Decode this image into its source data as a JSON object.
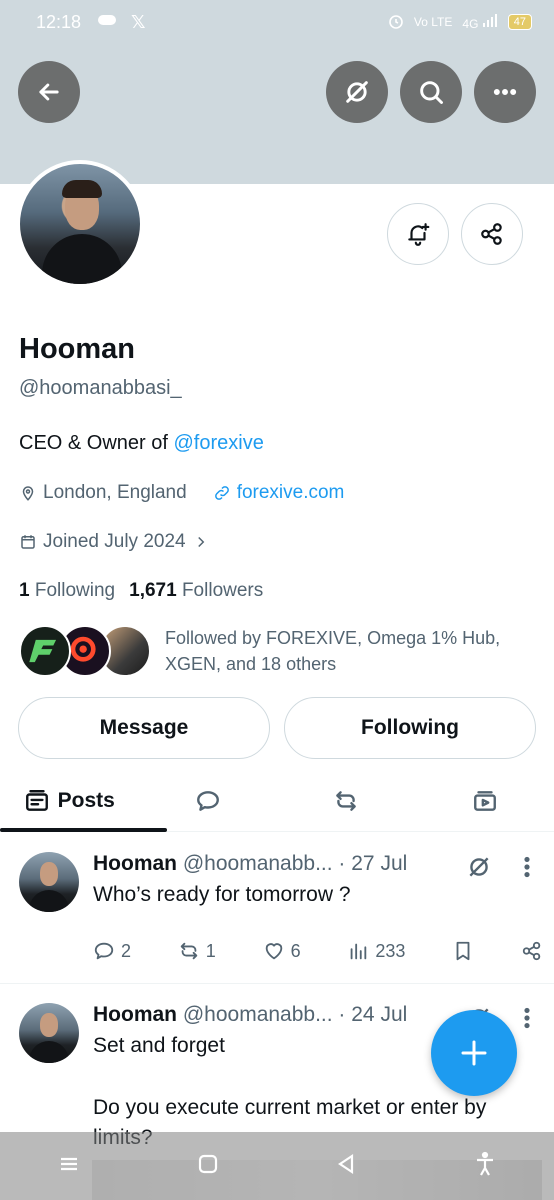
{
  "status_bar": {
    "time": "12:18",
    "network_label": "Vo LTE",
    "signal_label": "4G",
    "battery": "47"
  },
  "profile": {
    "name": "Hooman",
    "handle": "@hoomanabbasi_",
    "bio_prefix": "CEO & Owner of ",
    "bio_link": "@forexive",
    "location": "London, England",
    "website": "forexive.com",
    "joined": "Joined July 2024",
    "following_count": "1",
    "following_label": "Following",
    "followers_count": "1,671",
    "followers_label": "Followers",
    "followed_by": "Followed by FOREXIVE, Omega 1% Hub, XGEN, and 18 others"
  },
  "buttons": {
    "message": "Message",
    "following": "Following"
  },
  "tabs": [
    {
      "label": "Posts",
      "icon": "posts-icon",
      "active": true
    },
    {
      "label": "",
      "icon": "replies-icon",
      "active": false
    },
    {
      "label": "",
      "icon": "repost-icon",
      "active": false
    },
    {
      "label": "",
      "icon": "media-icon",
      "active": false
    }
  ],
  "posts": [
    {
      "name": "Hooman",
      "handle_date": "@hoomanabb... · 27 Jul",
      "text": "Who’s ready for tomorrow ?",
      "replies": "2",
      "reposts": "1",
      "likes": "6",
      "views": "233"
    },
    {
      "name": "Hooman",
      "handle_date": "@hoomanabb... · 24 Jul",
      "text_line1": "Set and forget",
      "text_line2": "Do you execute current market or enter by limits?"
    }
  ],
  "colors": {
    "accent": "#1d9bf0",
    "banner": "#cfd9de",
    "text_primary": "#0f1419",
    "text_secondary": "#536471"
  }
}
